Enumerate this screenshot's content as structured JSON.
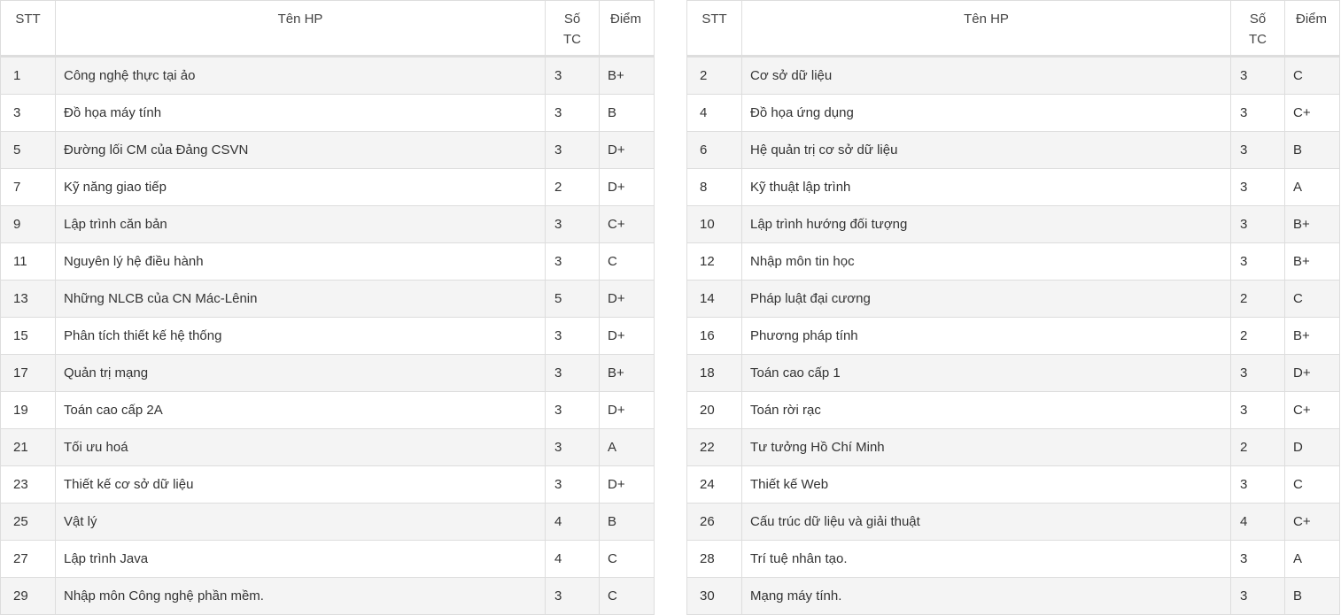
{
  "headers": {
    "stt": "STT",
    "name": "Tên HP",
    "credits": "Số TC",
    "grade": "Điểm"
  },
  "left": [
    {
      "stt": "1",
      "name": "Công nghệ thực tại ảo",
      "credits": "3",
      "grade": "B+"
    },
    {
      "stt": "3",
      "name": "Đồ họa máy tính",
      "credits": "3",
      "grade": "B"
    },
    {
      "stt": "5",
      "name": "Đường lối CM của Đảng CSVN",
      "credits": "3",
      "grade": "D+"
    },
    {
      "stt": "7",
      "name": "Kỹ năng giao tiếp",
      "credits": "2",
      "grade": "D+"
    },
    {
      "stt": "9",
      "name": "Lập trình căn bản",
      "credits": "3",
      "grade": "C+"
    },
    {
      "stt": "11",
      "name": "Nguyên lý hệ điều hành",
      "credits": "3",
      "grade": "C"
    },
    {
      "stt": "13",
      "name": "Những NLCB của CN Mác-Lênin",
      "credits": "5",
      "grade": "D+"
    },
    {
      "stt": "15",
      "name": "Phân tích thiết kế hệ thống",
      "credits": "3",
      "grade": "D+"
    },
    {
      "stt": "17",
      "name": "Quản trị mạng",
      "credits": "3",
      "grade": "B+"
    },
    {
      "stt": "19",
      "name": "Toán cao cấp 2A",
      "credits": "3",
      "grade": "D+"
    },
    {
      "stt": "21",
      "name": "Tối ưu hoá",
      "credits": "3",
      "grade": "A"
    },
    {
      "stt": "23",
      "name": "Thiết kế cơ sở dữ liệu",
      "credits": "3",
      "grade": "D+"
    },
    {
      "stt": "25",
      "name": "Vật lý",
      "credits": "4",
      "grade": "B"
    },
    {
      "stt": "27",
      "name": "Lập trình Java",
      "credits": "4",
      "grade": "C"
    },
    {
      "stt": "29",
      "name": "Nhập môn Công nghệ phần mềm.",
      "credits": "3",
      "grade": "C"
    }
  ],
  "right": [
    {
      "stt": "2",
      "name": "Cơ sở dữ liệu",
      "credits": "3",
      "grade": "C"
    },
    {
      "stt": "4",
      "name": "Đồ họa ứng dụng",
      "credits": "3",
      "grade": "C+"
    },
    {
      "stt": "6",
      "name": "Hệ quản trị cơ sở dữ liệu",
      "credits": "3",
      "grade": "B"
    },
    {
      "stt": "8",
      "name": "Kỹ thuật lập trình",
      "credits": "3",
      "grade": "A"
    },
    {
      "stt": "10",
      "name": "Lập trình hướng đối tượng",
      "credits": "3",
      "grade": "B+"
    },
    {
      "stt": "12",
      "name": "Nhập môn tin học",
      "credits": "3",
      "grade": "B+"
    },
    {
      "stt": "14",
      "name": "Pháp luật đại cương",
      "credits": "2",
      "grade": "C"
    },
    {
      "stt": "16",
      "name": "Phương pháp tính",
      "credits": "2",
      "grade": "B+"
    },
    {
      "stt": "18",
      "name": "Toán cao cấp 1",
      "credits": "3",
      "grade": "D+"
    },
    {
      "stt": "20",
      "name": "Toán rời rạc",
      "credits": "3",
      "grade": "C+"
    },
    {
      "stt": "22",
      "name": "Tư tưởng Hồ Chí Minh",
      "credits": "2",
      "grade": "D"
    },
    {
      "stt": "24",
      "name": "Thiết kế Web",
      "credits": "3",
      "grade": "C"
    },
    {
      "stt": "26",
      "name": "Cấu trúc dữ liệu và giải thuật",
      "credits": "4",
      "grade": "C+"
    },
    {
      "stt": "28",
      "name": "Trí tuệ nhân tạo.",
      "credits": "3",
      "grade": "A"
    },
    {
      "stt": "30",
      "name": "Mạng máy tính.",
      "credits": "3",
      "grade": "B"
    }
  ]
}
